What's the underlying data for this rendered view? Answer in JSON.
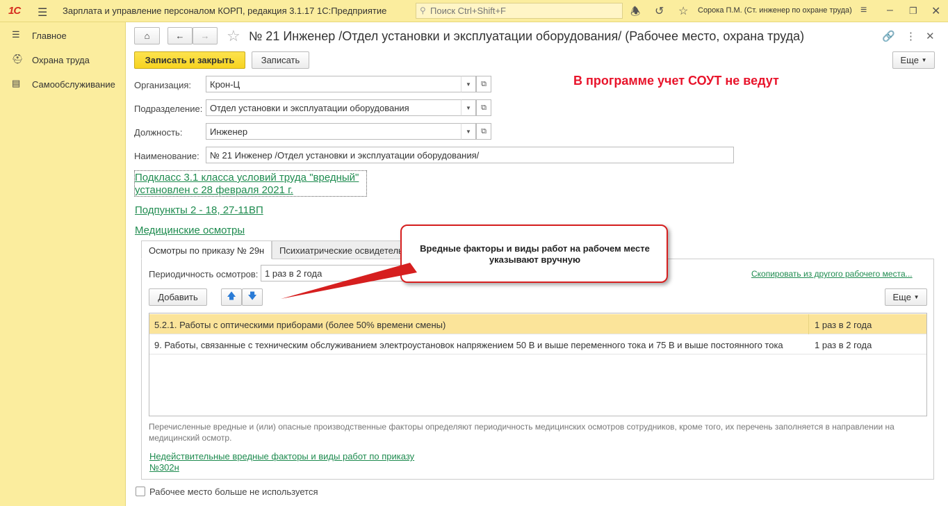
{
  "app": {
    "logo": "1С",
    "title": "Зарплата и управление персоналом КОРП, редакция 3.1.17 1С:Предприятие",
    "search_placeholder": "Поиск Ctrl+Shift+F",
    "user": "Сорока П.М. (Ст. инженер по охране труда)"
  },
  "sidebar": {
    "items": [
      {
        "label": "Главное",
        "icon": "list-icon"
      },
      {
        "label": "Охрана труда",
        "icon": "helmet-icon"
      },
      {
        "label": "Самообслуживание",
        "icon": "id-card-icon"
      }
    ]
  },
  "form": {
    "title": "№ 21 Инженер /Отдел установки и эксплуатации оборудования/ (Рабочее место, охрана труда)",
    "save_close_label": "Записать и закрыть",
    "save_label": "Записать",
    "more_label": "Еще",
    "warning": "В программе учет СОУТ не ведут",
    "fields": {
      "organization_label": "Организация:",
      "organization_value": "Крон-Ц",
      "department_label": "Подразделение:",
      "department_value": "Отдел установки и эксплуатации оборудования",
      "position_label": "Должность:",
      "position_value": "Инженер",
      "name_label": "Наименование:",
      "name_value": "№ 21 Инженер /Отдел установки и эксплуатации оборудования/"
    },
    "subclass_line1": "Подкласс 3.1 класса условий труда \"вредный\"",
    "subclass_line2": "установлен с 28 февраля 2021 г.",
    "subitems_link": "Подпункты 2 - 18, 27-11ВП",
    "med_link": "Медицинские осмотры",
    "tabs": [
      {
        "label": "Осмотры по приказу № 29н",
        "active": true
      },
      {
        "label": "Психиатрические освидетельствования",
        "active": false
      }
    ],
    "period_label": "Периодичность осмотров:",
    "period_value": "1 раз в 2 года",
    "copy_link": "Скопировать из другого рабочего места...",
    "add_label": "Добавить",
    "table_more_label": "Еще",
    "rows": [
      {
        "factor": "5.2.1. Работы с оптическими приборами (более 50% времени смены)",
        "period": "1 раз в 2 года",
        "selected": true
      },
      {
        "factor": "9. Работы, связанные с техническим обслуживанием электроустановок напряжением 50 В и выше переменного тока и 75 В и выше постоянного тока",
        "period": "1 раз в 2 года",
        "selected": false
      }
    ],
    "note": "Перечисленные вредные и (или) опасные производственные факторы определяют периодичность медицинских осмотров сотрудников, кроме того, их перечень заполняется в направлении на медицинский осмотр.",
    "invalid_link_line1": "Недействительные вредные факторы и виды работ по приказу",
    "invalid_link_line2": "№302н",
    "unused_label": "Рабочее место больше не используется",
    "callout": "Вредные факторы и виды работ на рабочем месте указывают вручную"
  },
  "colors": {
    "topbar": "#fbed9e",
    "primary_button": "#f7d320",
    "link": "#1e8b4f",
    "warning": "#e8142b",
    "selected_row": "#fbe49a"
  }
}
